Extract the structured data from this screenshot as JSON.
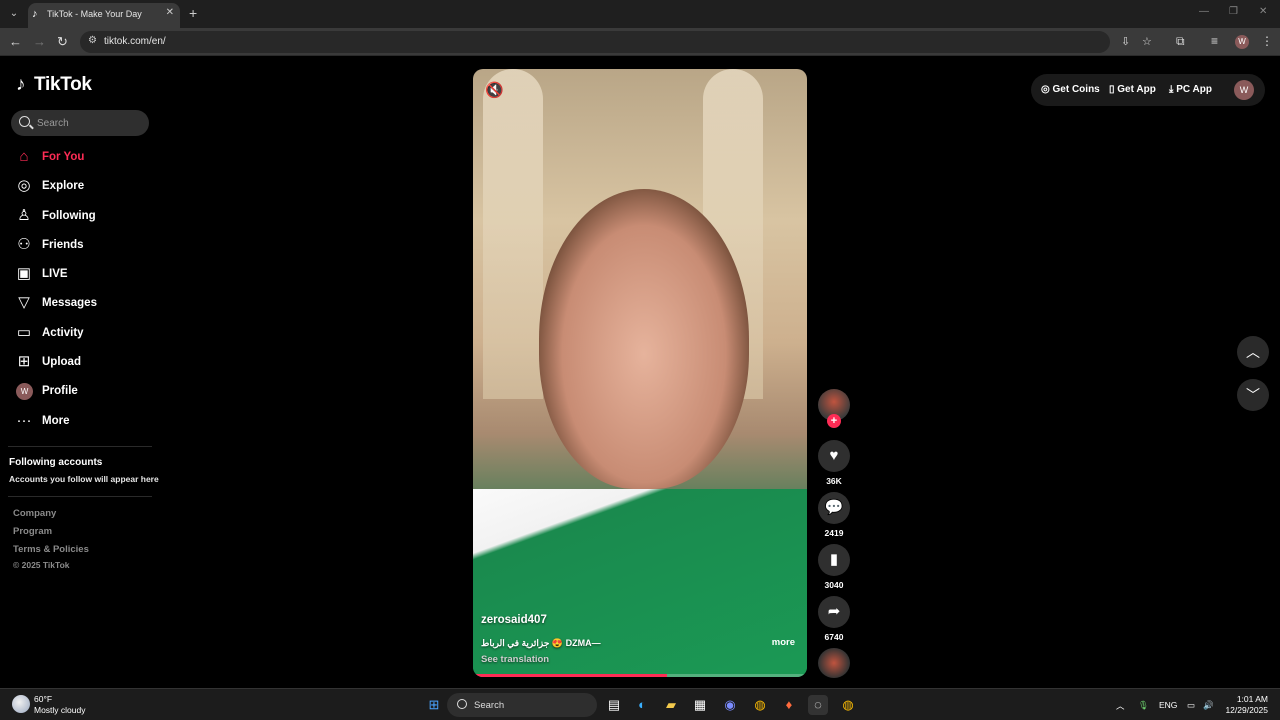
{
  "browser": {
    "tab_title": "TikTok - Make Your Day",
    "url": "tiktok.com/en/",
    "profile_initial": "W"
  },
  "sidebar": {
    "logo_text": "TikTok",
    "search_placeholder": "Search",
    "nav": [
      {
        "label": "For You",
        "icon": "home-icon",
        "active": true
      },
      {
        "label": "Explore",
        "icon": "compass-icon"
      },
      {
        "label": "Following",
        "icon": "person-follow-icon"
      },
      {
        "label": "Friends",
        "icon": "friends-icon"
      },
      {
        "label": "LIVE",
        "icon": "live-icon"
      },
      {
        "label": "Messages",
        "icon": "send-icon"
      },
      {
        "label": "Activity",
        "icon": "activity-icon"
      },
      {
        "label": "Upload",
        "icon": "upload-icon"
      },
      {
        "label": "Profile",
        "icon": "avatar"
      },
      {
        "label": "More",
        "icon": "more-icon"
      }
    ],
    "profile_initial": "W",
    "following_title": "Following accounts",
    "following_subtitle": "Accounts you follow will appear here",
    "footer": [
      "Company",
      "Program",
      "Terms & Policies"
    ],
    "copyright": "© 2025 TikTok"
  },
  "video": {
    "username": "zerosaid407",
    "caption": "جزائرية في الرباط 😍 DZMA—",
    "see_translation": "See translation",
    "more": "more",
    "progress": 0.58
  },
  "actions": {
    "likes": "36K",
    "comments": "2419",
    "saves": "3040",
    "shares": "6740"
  },
  "topbar": {
    "get_coins": "Get Coins",
    "get_app": "Get App",
    "pc_app": "PC App",
    "avatar_initial": "W"
  },
  "taskbar": {
    "temp": "60°F",
    "weather": "Mostly cloudy",
    "search": "Search",
    "lang": "ENG",
    "time": "1:01 AM",
    "date": "12/29/2025"
  },
  "colors": {
    "accent": "#fe2c55",
    "background": "#000000"
  }
}
